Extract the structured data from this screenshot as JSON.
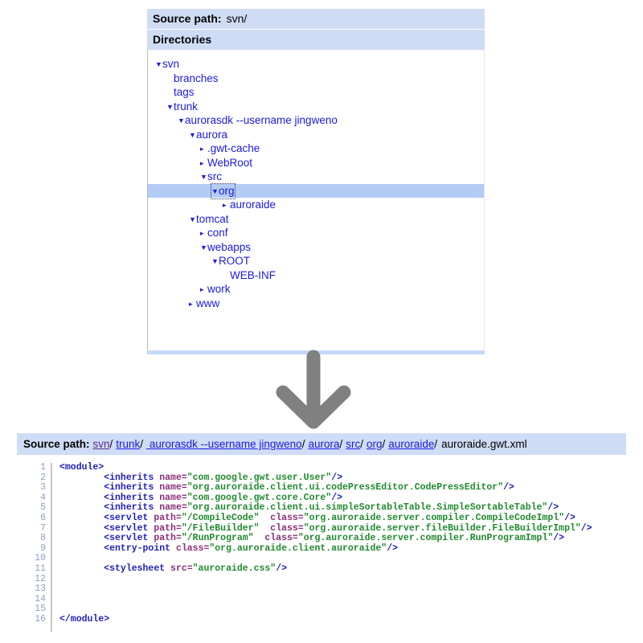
{
  "tree_panel": {
    "source_path_label": "Source path:",
    "source_path_value": "svn/",
    "directories_label": "Directories",
    "nodes": [
      {
        "label": "svn",
        "depth": 0,
        "state": "expanded",
        "selected": false
      },
      {
        "label": "branches",
        "depth": 1,
        "state": "leaf",
        "selected": false
      },
      {
        "label": "tags",
        "depth": 1,
        "state": "leaf",
        "selected": false
      },
      {
        "label": "trunk",
        "depth": 1,
        "state": "expanded",
        "selected": false
      },
      {
        "label": "aurorasdk --username jingweno",
        "depth": 2,
        "state": "expanded",
        "selected": false
      },
      {
        "label": "aurora",
        "depth": 3,
        "state": "expanded",
        "selected": false
      },
      {
        "label": ".gwt-cache",
        "depth": 4,
        "state": "collapsed",
        "selected": false
      },
      {
        "label": "WebRoot",
        "depth": 4,
        "state": "collapsed",
        "selected": false
      },
      {
        "label": "src",
        "depth": 4,
        "state": "expanded",
        "selected": false
      },
      {
        "label": "org",
        "depth": 5,
        "state": "expanded",
        "selected": true
      },
      {
        "label": "auroraide",
        "depth": 6,
        "state": "collapsed",
        "selected": false
      },
      {
        "label": "tomcat",
        "depth": 3,
        "state": "expanded",
        "selected": false
      },
      {
        "label": "conf",
        "depth": 4,
        "state": "collapsed",
        "selected": false
      },
      {
        "label": "webapps",
        "depth": 4,
        "state": "expanded",
        "selected": false
      },
      {
        "label": "ROOT",
        "depth": 5,
        "state": "expanded",
        "selected": false
      },
      {
        "label": "WEB-INF",
        "depth": 6,
        "state": "leaf",
        "selected": false
      },
      {
        "label": "work",
        "depth": 4,
        "state": "collapsed",
        "selected": false
      },
      {
        "label": "www",
        "depth": 3,
        "state": "collapsed",
        "selected": false
      }
    ],
    "expanded_glyph": "▼",
    "collapsed_glyph": "▸"
  },
  "arrow": {
    "name": "down-arrow-icon",
    "color": "#808080"
  },
  "breadcrumb": {
    "title": "Source path:",
    "separator": "/",
    "links": [
      {
        "label": "svn",
        "visited": true
      },
      {
        "label": "trunk",
        "visited": false
      },
      {
        "label": " aurorasdk --username jingweno",
        "visited": false
      },
      {
        "label": "aurora",
        "visited": false
      },
      {
        "label": "src",
        "visited": false
      },
      {
        "label": "org",
        "visited": false
      },
      {
        "label": "auroraide",
        "visited": false
      }
    ],
    "filename": "auroraide.gwt.xml"
  },
  "code_viewer": {
    "line_numbers": [
      1,
      2,
      3,
      4,
      5,
      6,
      7,
      8,
      9,
      10,
      11,
      12,
      13,
      14,
      15,
      16
    ],
    "lines": [
      [
        {
          "t": "tag",
          "v": "<module>"
        }
      ],
      [
        {
          "t": "pl",
          "v": "        "
        },
        {
          "t": "tag",
          "v": "<inherits "
        },
        {
          "t": "att",
          "v": "name="
        },
        {
          "t": "str",
          "v": "\"com.google.gwt.user.User\""
        },
        {
          "t": "tag",
          "v": "/>"
        }
      ],
      [
        {
          "t": "pl",
          "v": "        "
        },
        {
          "t": "tag",
          "v": "<inherits "
        },
        {
          "t": "att",
          "v": "name="
        },
        {
          "t": "str",
          "v": "\"org.auroraide.client.ui.codePressEditor.CodePressEditor\""
        },
        {
          "t": "tag",
          "v": "/>"
        }
      ],
      [
        {
          "t": "pl",
          "v": "        "
        },
        {
          "t": "tag",
          "v": "<inherits "
        },
        {
          "t": "att",
          "v": "name="
        },
        {
          "t": "str",
          "v": "\"com.google.gwt.core.Core\""
        },
        {
          "t": "tag",
          "v": "/>"
        }
      ],
      [
        {
          "t": "pl",
          "v": "        "
        },
        {
          "t": "tag",
          "v": "<inherits "
        },
        {
          "t": "att",
          "v": "name="
        },
        {
          "t": "str",
          "v": "\"org.auroraide.client.ui.simpleSortableTable.SimpleSortableTable\""
        },
        {
          "t": "tag",
          "v": "/>"
        }
      ],
      [
        {
          "t": "pl",
          "v": "        "
        },
        {
          "t": "tag",
          "v": "<servlet "
        },
        {
          "t": "att",
          "v": "path="
        },
        {
          "t": "str",
          "v": "\"/CompileCode\""
        },
        {
          "t": "pl",
          "v": "  "
        },
        {
          "t": "att",
          "v": "class="
        },
        {
          "t": "str",
          "v": "\"org.auroraide.server.compiler.CompileCodeImpl\""
        },
        {
          "t": "tag",
          "v": "/>"
        }
      ],
      [
        {
          "t": "pl",
          "v": "        "
        },
        {
          "t": "tag",
          "v": "<servlet "
        },
        {
          "t": "att",
          "v": "path="
        },
        {
          "t": "str",
          "v": "\"/FileBuilder\""
        },
        {
          "t": "pl",
          "v": "  "
        },
        {
          "t": "att",
          "v": "class="
        },
        {
          "t": "str",
          "v": "\"org.auroraide.server.fileBuilder.FileBuilderImpl\""
        },
        {
          "t": "tag",
          "v": "/>"
        }
      ],
      [
        {
          "t": "pl",
          "v": "        "
        },
        {
          "t": "tag",
          "v": "<servlet "
        },
        {
          "t": "att",
          "v": "path="
        },
        {
          "t": "str",
          "v": "\"/RunProgram\""
        },
        {
          "t": "pl",
          "v": "  "
        },
        {
          "t": "att",
          "v": "class="
        },
        {
          "t": "str",
          "v": "\"org.auroraide.server.compiler.RunProgramImpl\""
        },
        {
          "t": "tag",
          "v": "/>"
        }
      ],
      [
        {
          "t": "pl",
          "v": "        "
        },
        {
          "t": "tag",
          "v": "<entry-point "
        },
        {
          "t": "att",
          "v": "class="
        },
        {
          "t": "str",
          "v": "\"org.auroraide.client.auroraide\""
        },
        {
          "t": "tag",
          "v": "/>"
        }
      ],
      [],
      [
        {
          "t": "pl",
          "v": "        "
        },
        {
          "t": "tag",
          "v": "<stylesheet "
        },
        {
          "t": "att",
          "v": "src="
        },
        {
          "t": "str",
          "v": "\"auroraide.css\""
        },
        {
          "t": "tag",
          "v": "/>"
        }
      ],
      [],
      [],
      [],
      [],
      [
        {
          "t": "tag",
          "v": "</module>"
        }
      ]
    ]
  }
}
